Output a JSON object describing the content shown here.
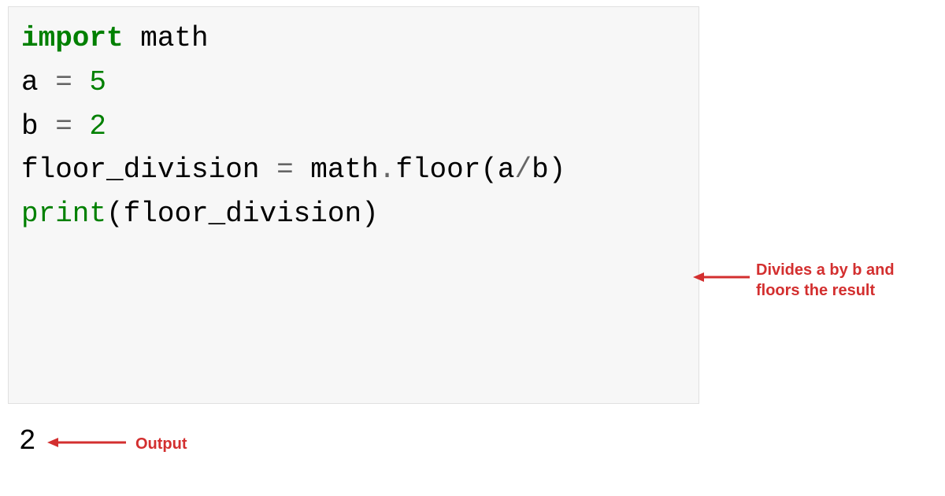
{
  "code": {
    "line1_import": "import",
    "line1_math": " math",
    "blank": "",
    "line3_a": "a ",
    "line3_eq": "=",
    "line3_5": " 5",
    "line4_b": "b ",
    "line4_eq": "=",
    "line4_2": " 2",
    "line6_floor": "floor_division ",
    "line6_eq": "=",
    "line6_math": " math",
    "line6_dot": ".",
    "line6_floorfn": "floor(a",
    "line6_slash": "/",
    "line6_b": "b)",
    "line8_print": "print",
    "line8_args": "(floor_division)"
  },
  "output": "2",
  "annotations": {
    "divides": "Divides a by b and floors the result",
    "output": "Output"
  },
  "colors": {
    "red": "#d32f2f",
    "grey_bg": "#f7f7f7"
  }
}
